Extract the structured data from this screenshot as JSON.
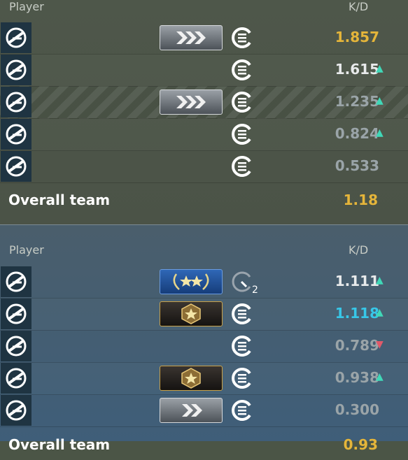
{
  "team1": {
    "header": {
      "player": "Player",
      "kd": "K/D"
    },
    "rows": [
      {
        "kd": "1.857",
        "kd_color": "#e5b53a",
        "trend": "",
        "trend_color": "#40d8b8",
        "rank": "silver-chevrons",
        "medal": "service-medal"
      },
      {
        "kd": "1.615",
        "kd_color": "#e8eaeb",
        "trend": "▲",
        "trend_color": "#40d8b8",
        "rank": "",
        "medal": "service-medal"
      },
      {
        "kd": "1.235",
        "kd_color": "#9aa4a8",
        "trend": "▲",
        "trend_color": "#40d8b8",
        "rank": "silver-chevrons",
        "medal": "service-medal"
      },
      {
        "kd": "0.824",
        "kd_color": "#9aa4a8",
        "trend": "▲",
        "trend_color": "#40d8b8",
        "rank": "",
        "medal": "service-medal"
      },
      {
        "kd": "0.533",
        "kd_color": "#9aa4a8",
        "trend": "",
        "trend_color": "#40d8b8",
        "rank": "",
        "medal": "service-medal"
      }
    ],
    "overall": {
      "label": "Overall team",
      "value": "1.18"
    }
  },
  "team2": {
    "header": {
      "player": "Player",
      "kd": "K/D"
    },
    "rows": [
      {
        "kd": "1.111",
        "kd_color": "#e8eaeb",
        "trend": "▲",
        "trend_color": "#40d8b8",
        "rank": "blue-two-stars",
        "medal": "timer-medal",
        "medal_count": "2"
      },
      {
        "kd": "1.118",
        "kd_color": "#37c7e8",
        "trend": "▲",
        "trend_color": "#40d8b8",
        "rank": "gold-star",
        "medal": "service-medal"
      },
      {
        "kd": "0.789",
        "kd_color": "#9aa4a8",
        "trend": "▼",
        "trend_color": "#e05a6a",
        "rank": "",
        "medal": "service-medal"
      },
      {
        "kd": "0.938",
        "kd_color": "#9aa4a8",
        "trend": "▲",
        "trend_color": "#40d8b8",
        "rank": "gold-star",
        "medal": "service-medal"
      },
      {
        "kd": "0.300",
        "kd_color": "#9aa4a8",
        "trend": "",
        "trend_color": "#40d8b8",
        "rank": "silver-chevrons",
        "medal": "service-medal"
      }
    ],
    "overall": {
      "label": "Overall team",
      "value": "0.93"
    }
  }
}
